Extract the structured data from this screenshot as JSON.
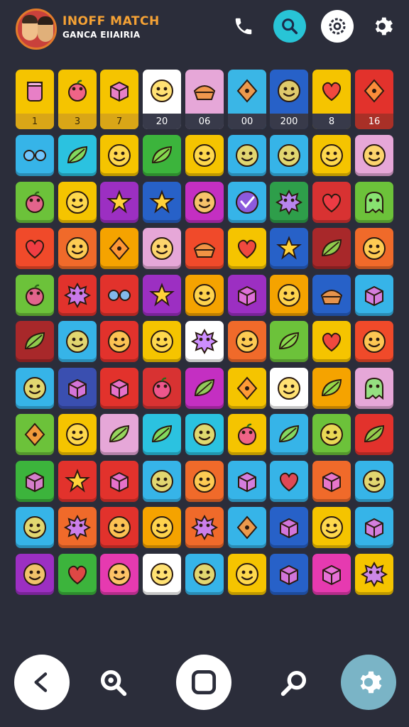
{
  "header": {
    "title": "INOFF MATCH",
    "subtitle": "GANCA EIIAIRIA",
    "icons": [
      "phone-icon",
      "search-icon",
      "settings-icon",
      "gear-icon"
    ]
  },
  "board": {
    "rows": [
      [
        {
          "color": "#f5c400",
          "face": "jar",
          "label": "1",
          "labelStyle": "yellow"
        },
        {
          "color": "#f5c400",
          "face": "apple",
          "label": "3",
          "labelStyle": "yellow"
        },
        {
          "color": "#f5c400",
          "face": "box",
          "label": "7",
          "labelStyle": "yellow"
        },
        {
          "color": "#ffffff",
          "face": "smile",
          "label": "20",
          "labelStyle": "dark"
        },
        {
          "color": "#e6a7d8",
          "face": "pie",
          "label": "06",
          "labelStyle": "dark"
        },
        {
          "color": "#3ab6e6",
          "face": "diamond",
          "label": "00",
          "labelStyle": "dark"
        },
        {
          "color": "#2761c8",
          "face": "smile",
          "label": "200",
          "labelStyle": "dark"
        },
        {
          "color": "#f5c400",
          "face": "heart",
          "label": "8",
          "labelStyle": "dark"
        },
        {
          "color": "#e2322c",
          "face": "diamond",
          "label": "16",
          "labelStyle": "red"
        }
      ],
      [
        {
          "color": "#36b4e8",
          "face": "glasses"
        },
        {
          "color": "#2bc2e0",
          "face": "leaf"
        },
        {
          "color": "#f5c400",
          "face": "smile"
        },
        {
          "color": "#3cb43c",
          "face": "leaf"
        },
        {
          "color": "#f5c400",
          "face": "smile"
        },
        {
          "color": "#36b4e8",
          "face": "smile"
        },
        {
          "color": "#36b4e8",
          "face": "smile"
        },
        {
          "color": "#f5c400",
          "face": "smile"
        },
        {
          "color": "#e6a7d8",
          "face": "smile"
        }
      ],
      [
        {
          "color": "#6cc23a",
          "face": "apple"
        },
        {
          "color": "#f5c400",
          "face": "smile"
        },
        {
          "color": "#9c2fc2",
          "face": "star"
        },
        {
          "color": "#2761c8",
          "face": "star"
        },
        {
          "color": "#c42fc2",
          "face": "smile"
        },
        {
          "color": "#36b4e8",
          "face": "check"
        },
        {
          "color": "#2e9e4a",
          "face": "sun"
        },
        {
          "color": "#d83232",
          "face": "heart"
        },
        {
          "color": "#6cc23a",
          "face": "ghost"
        }
      ],
      [
        {
          "color": "#f04a2a",
          "face": "heart"
        },
        {
          "color": "#f06a2a",
          "face": "smile"
        },
        {
          "color": "#f5a300",
          "face": "diamond"
        },
        {
          "color": "#e6a7d8",
          "face": "smile"
        },
        {
          "color": "#f04a2a",
          "face": "pie"
        },
        {
          "color": "#f5c400",
          "face": "heart"
        },
        {
          "color": "#2761c8",
          "face": "star"
        },
        {
          "color": "#a8282a",
          "face": "leaf"
        },
        {
          "color": "#f06a2a",
          "face": "smile"
        }
      ],
      [
        {
          "color": "#6cc23a",
          "face": "apple"
        },
        {
          "color": "#e2322c",
          "face": "sun"
        },
        {
          "color": "#e2322c",
          "face": "glasses"
        },
        {
          "color": "#9c2fc2",
          "face": "star"
        },
        {
          "color": "#f5a300",
          "face": "smile"
        },
        {
          "color": "#9c2fc2",
          "face": "box"
        },
        {
          "color": "#f5a300",
          "face": "smile"
        },
        {
          "color": "#2761c8",
          "face": "pie"
        },
        {
          "color": "#36b4e8",
          "face": "box"
        }
      ],
      [
        {
          "color": "#a8282a",
          "face": "leaf"
        },
        {
          "color": "#36b4e8",
          "face": "smile"
        },
        {
          "color": "#e2322c",
          "face": "smile"
        },
        {
          "color": "#f5c400",
          "face": "smile"
        },
        {
          "color": "#ffffff",
          "face": "sun"
        },
        {
          "color": "#f06a2a",
          "face": "smile"
        },
        {
          "color": "#6cc23a",
          "face": "leaf"
        },
        {
          "color": "#f5c400",
          "face": "heart"
        },
        {
          "color": "#f04a2a",
          "face": "smile"
        }
      ],
      [
        {
          "color": "#36b4e8",
          "face": "smile"
        },
        {
          "color": "#3a4fb0",
          "face": "box"
        },
        {
          "color": "#e2322c",
          "face": "box"
        },
        {
          "color": "#d83232",
          "face": "apple"
        },
        {
          "color": "#c42fc2",
          "face": "leaf"
        },
        {
          "color": "#f5c400",
          "face": "diamond"
        },
        {
          "color": "#ffffff",
          "face": "smile"
        },
        {
          "color": "#f5a300",
          "face": "leaf"
        },
        {
          "color": "#e6a7d8",
          "face": "ghost"
        }
      ],
      [
        {
          "color": "#6cc23a",
          "face": "diamond"
        },
        {
          "color": "#f5c400",
          "face": "smile"
        },
        {
          "color": "#e6a7d8",
          "face": "leaf"
        },
        {
          "color": "#2bc2e0",
          "face": "leaf"
        },
        {
          "color": "#2bc2e0",
          "face": "smile"
        },
        {
          "color": "#f5c400",
          "face": "apple"
        },
        {
          "color": "#36b4e8",
          "face": "leaf"
        },
        {
          "color": "#6cc23a",
          "face": "smile"
        },
        {
          "color": "#e2322c",
          "face": "leaf"
        }
      ],
      [
        {
          "color": "#3cb43c",
          "face": "box"
        },
        {
          "color": "#e2322c",
          "face": "star"
        },
        {
          "color": "#e2322c",
          "face": "box"
        },
        {
          "color": "#36b4e8",
          "face": "smile"
        },
        {
          "color": "#f06a2a",
          "face": "smile"
        },
        {
          "color": "#36b4e8",
          "face": "box"
        },
        {
          "color": "#36b4e8",
          "face": "heart"
        },
        {
          "color": "#f06a2a",
          "face": "box"
        },
        {
          "color": "#36b4e8",
          "face": "smile"
        }
      ],
      [
        {
          "color": "#36b4e8",
          "face": "smile"
        },
        {
          "color": "#f06a2a",
          "face": "sun"
        },
        {
          "color": "#e2322c",
          "face": "smile"
        },
        {
          "color": "#f5a300",
          "face": "smile"
        },
        {
          "color": "#f06a2a",
          "face": "sun"
        },
        {
          "color": "#36b4e8",
          "face": "diamond"
        },
        {
          "color": "#2761c8",
          "face": "box"
        },
        {
          "color": "#f5c400",
          "face": "smile"
        },
        {
          "color": "#36b4e8",
          "face": "box"
        }
      ],
      [
        {
          "color": "#9c2fc2",
          "face": "smile"
        },
        {
          "color": "#3cb43c",
          "face": "heart"
        },
        {
          "color": "#e63ab0",
          "face": "smile"
        },
        {
          "color": "#ffffff",
          "face": "smile"
        },
        {
          "color": "#36b4e8",
          "face": "smile"
        },
        {
          "color": "#f5c400",
          "face": "smile"
        },
        {
          "color": "#2761c8",
          "face": "box"
        },
        {
          "color": "#e63ab0",
          "face": "box"
        },
        {
          "color": "#f5c400",
          "face": "sun"
        }
      ]
    ]
  },
  "nav": {
    "icons": [
      "back-icon",
      "search-icon",
      "home-icon",
      "pin-icon",
      "gear-icon"
    ]
  }
}
